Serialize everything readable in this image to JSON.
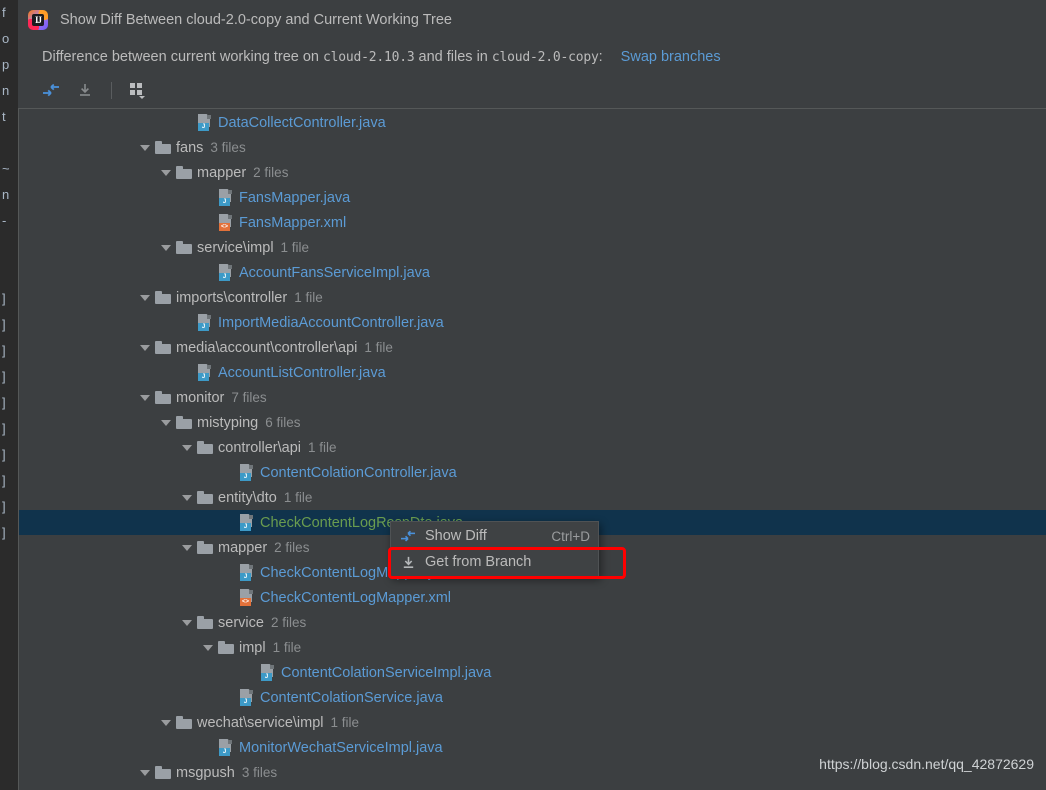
{
  "window": {
    "logo_icon": "intellij-idea-logo",
    "logo_text": "IJ",
    "title": "Show Diff Between cloud-2.0-copy and Current Working Tree"
  },
  "description": {
    "prefix": "Difference between current working tree on",
    "branch_current": "cloud-2.10.3",
    "middle": "and files in",
    "branch_other": "cloud-2.0-copy",
    "colon": ":",
    "swap_link": "Swap branches"
  },
  "toolbar": {
    "buttons": [
      {
        "name": "show-diff-button",
        "icon": "show-diff-arrows-icon",
        "enabled": true
      },
      {
        "name": "get-from-branch-button",
        "icon": "download-arrow-icon",
        "enabled": false
      },
      {
        "name": "group-by-button",
        "icon": "group-by-grid-icon",
        "enabled": true
      }
    ]
  },
  "tree": {
    "rows": [
      {
        "indent": 4,
        "type": "file",
        "icon": "java-file-icon",
        "name": "DataCollectController.java",
        "count": "",
        "state": "normal",
        "selected": false
      },
      {
        "indent": 2,
        "type": "folder",
        "icon": "folder-icon",
        "name": "fans",
        "count": "3 files",
        "state": "normal",
        "selected": false
      },
      {
        "indent": 3,
        "type": "folder",
        "icon": "folder-icon",
        "name": "mapper",
        "count": "2 files",
        "state": "normal",
        "selected": false
      },
      {
        "indent": 5,
        "type": "file",
        "icon": "java-file-icon",
        "name": "FansMapper.java",
        "count": "",
        "state": "normal",
        "selected": false
      },
      {
        "indent": 5,
        "type": "file",
        "icon": "xml-file-icon",
        "name": "FansMapper.xml",
        "count": "",
        "state": "normal",
        "selected": false
      },
      {
        "indent": 3,
        "type": "folder",
        "icon": "folder-icon",
        "name": "service\\impl",
        "count": "1 file",
        "state": "normal",
        "selected": false
      },
      {
        "indent": 5,
        "type": "file",
        "icon": "java-file-icon",
        "name": "AccountFansServiceImpl.java",
        "count": "",
        "state": "normal",
        "selected": false
      },
      {
        "indent": 2,
        "type": "folder",
        "icon": "folder-icon",
        "name": "imports\\controller",
        "count": "1 file",
        "state": "normal",
        "selected": false
      },
      {
        "indent": 4,
        "type": "file",
        "icon": "java-file-icon",
        "name": "ImportMediaAccountController.java",
        "count": "",
        "state": "normal",
        "selected": false
      },
      {
        "indent": 2,
        "type": "folder",
        "icon": "folder-icon",
        "name": "media\\account\\controller\\api",
        "count": "1 file",
        "state": "normal",
        "selected": false
      },
      {
        "indent": 4,
        "type": "file",
        "icon": "java-file-icon",
        "name": "AccountListController.java",
        "count": "",
        "state": "normal",
        "selected": false
      },
      {
        "indent": 2,
        "type": "folder",
        "icon": "folder-icon",
        "name": "monitor",
        "count": "7 files",
        "state": "normal",
        "selected": false
      },
      {
        "indent": 3,
        "type": "folder",
        "icon": "folder-icon",
        "name": "mistyping",
        "count": "6 files",
        "state": "normal",
        "selected": false
      },
      {
        "indent": 4,
        "type": "folder",
        "icon": "folder-icon",
        "name": "controller\\api",
        "count": "1 file",
        "state": "normal",
        "selected": false
      },
      {
        "indent": 6,
        "type": "file",
        "icon": "java-file-icon",
        "name": "ContentColationController.java",
        "count": "",
        "state": "normal",
        "selected": false
      },
      {
        "indent": 4,
        "type": "folder",
        "icon": "folder-icon",
        "name": "entity\\dto",
        "count": "1 file",
        "state": "normal",
        "selected": false
      },
      {
        "indent": 6,
        "type": "file",
        "icon": "java-file-icon",
        "name": "CheckContentLogRespDto.java",
        "count": "",
        "state": "added",
        "selected": true
      },
      {
        "indent": 4,
        "type": "folder",
        "icon": "folder-icon",
        "name": "mapper",
        "count": "2 files",
        "state": "normal",
        "selected": false
      },
      {
        "indent": 6,
        "type": "file",
        "icon": "java-file-icon",
        "name": "CheckContentLogMapper.java",
        "count": "",
        "state": "normal",
        "selected": false
      },
      {
        "indent": 6,
        "type": "file",
        "icon": "xml-file-icon",
        "name": "CheckContentLogMapper.xml",
        "count": "",
        "state": "normal",
        "selected": false
      },
      {
        "indent": 4,
        "type": "folder",
        "icon": "folder-icon",
        "name": "service",
        "count": "2 files",
        "state": "normal",
        "selected": false
      },
      {
        "indent": 5,
        "type": "folder",
        "icon": "folder-icon",
        "name": "impl",
        "count": "1 file",
        "state": "normal",
        "selected": false
      },
      {
        "indent": 7,
        "type": "file",
        "icon": "java-file-icon",
        "name": "ContentColationServiceImpl.java",
        "count": "",
        "state": "normal",
        "selected": false
      },
      {
        "indent": 6,
        "type": "file",
        "icon": "java-file-icon",
        "name": "ContentColationService.java",
        "count": "",
        "state": "normal",
        "selected": false
      },
      {
        "indent": 3,
        "type": "folder",
        "icon": "folder-icon",
        "name": "wechat\\service\\impl",
        "count": "1 file",
        "state": "normal",
        "selected": false
      },
      {
        "indent": 5,
        "type": "file",
        "icon": "java-file-icon",
        "name": "MonitorWechatServiceImpl.java",
        "count": "",
        "state": "normal",
        "selected": false
      },
      {
        "indent": 2,
        "type": "folder",
        "icon": "folder-icon",
        "name": "msgpush",
        "count": "3 files",
        "state": "normal",
        "selected": false
      }
    ]
  },
  "context_menu": {
    "items": [
      {
        "icon": "show-diff-arrows-icon",
        "label": "Show Diff",
        "shortcut": "Ctrl+D",
        "highlighted": false
      },
      {
        "icon": "download-arrow-icon",
        "label": "Get from Branch",
        "shortcut": "",
        "highlighted": true
      }
    ]
  },
  "annotation": {
    "color": "#ff0000",
    "target": "Get from Branch"
  },
  "watermark": {
    "text": "https://blog.csdn.net/qq_42872629"
  },
  "background_sliver": {
    "lines": [
      "f",
      "o",
      "p",
      "n",
      "t",
      "",
      "~",
      "n",
      "-",
      "",
      "",
      "]",
      "]",
      "]",
      "]",
      "]",
      "]",
      "]",
      "]",
      "]",
      "]"
    ]
  },
  "colors": {
    "dialog_background": "#3c3f41",
    "selection": "#10334c",
    "link": "#5b9bd5",
    "file_name": "#5b9bd5",
    "added_file_name": "#6a9c4f",
    "folder_name": "#bbbbbb",
    "count_text": "#8b8e90",
    "annotation_red": "#ff0000"
  }
}
